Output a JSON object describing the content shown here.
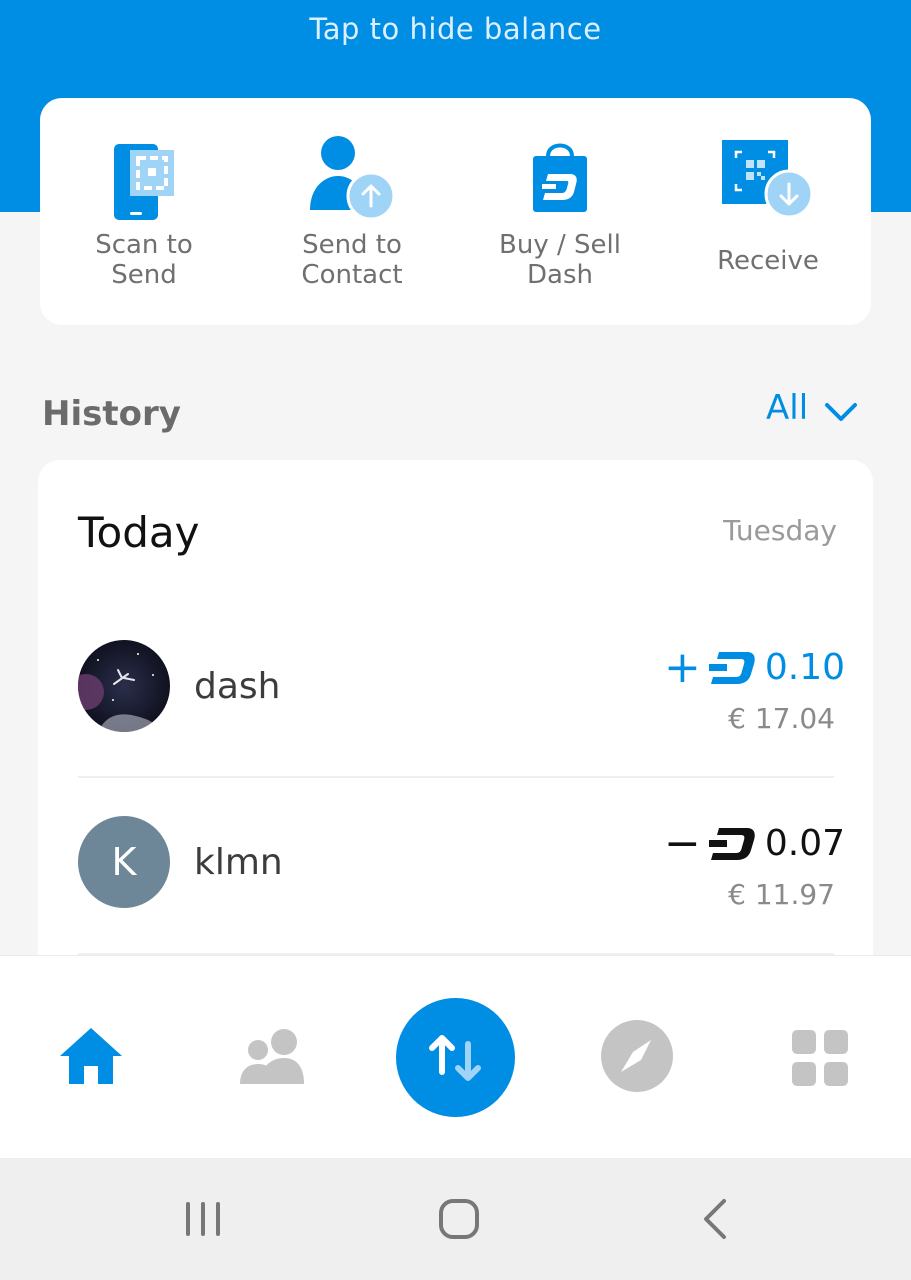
{
  "header": {
    "hide_balance_text": "Tap to hide balance"
  },
  "actions": [
    {
      "label": "Scan to\nSend",
      "icon": "scan-qr-icon"
    },
    {
      "label": "Send to\nContact",
      "icon": "contact-send-icon"
    },
    {
      "label": "Buy / Sell\nDash",
      "icon": "shopping-bag-dash-icon"
    },
    {
      "label": "Receive",
      "icon": "receive-qr-icon"
    }
  ],
  "history": {
    "title": "History",
    "filter_label": "All",
    "group_title": "Today",
    "group_weekday": "Tuesday",
    "transactions": [
      {
        "name": "dash",
        "sign": "+",
        "amount": "0.10",
        "fiat": "€ 17.04",
        "direction": "incoming",
        "avatar": "space-photo"
      },
      {
        "name": "klmn",
        "sign": "−",
        "amount": "0.07",
        "fiat": "€ 11.97",
        "direction": "outgoing",
        "avatar_letter": "K"
      }
    ]
  },
  "nav": {
    "items": [
      "home-icon",
      "contacts-icon",
      "send-receive-icon",
      "explore-icon",
      "more-apps-icon"
    ],
    "active": "home-icon"
  },
  "colors": {
    "accent": "#008de4",
    "incoming": "#008de4",
    "outgoing": "#111111",
    "avatar_bg": "#6e8798"
  }
}
